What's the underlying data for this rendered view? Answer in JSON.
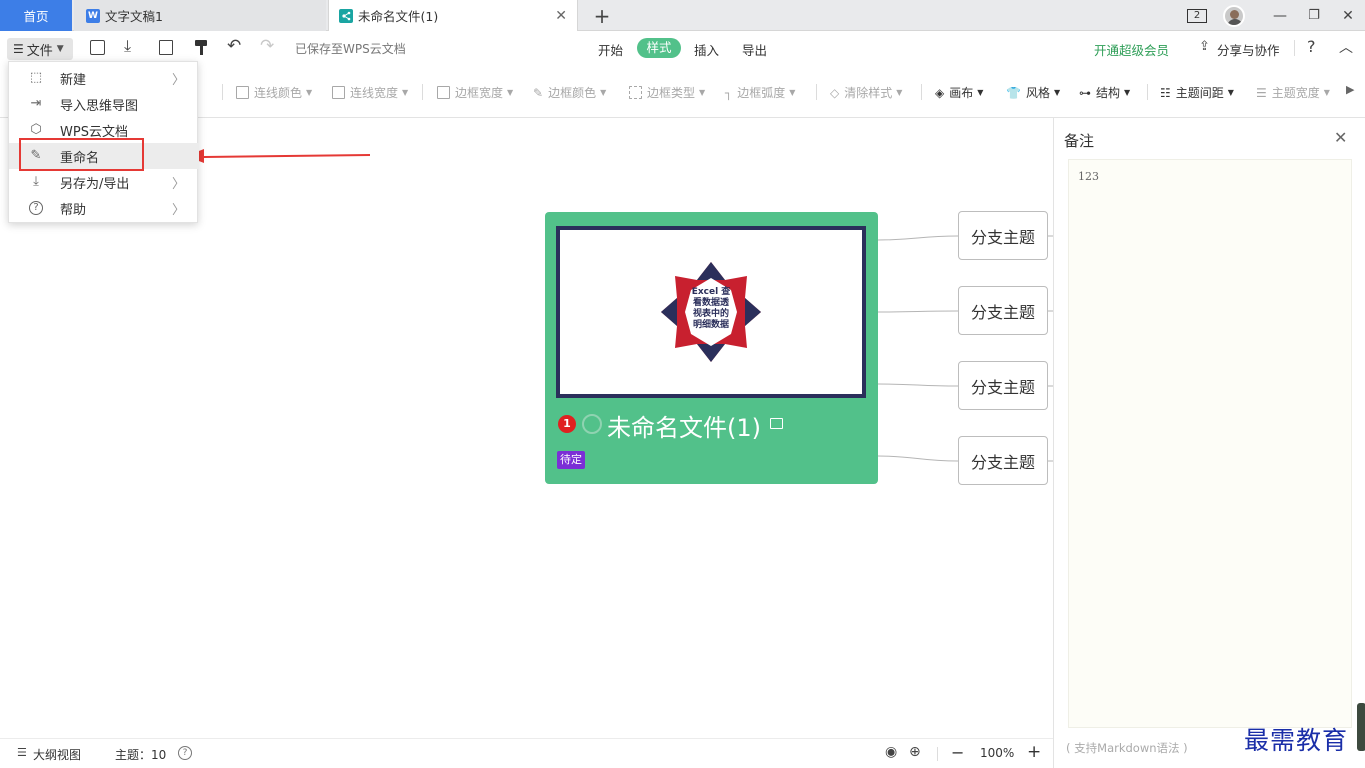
{
  "tabs": {
    "home": "首页",
    "doc": "文字文稿1",
    "mind": "未命名文件(1)"
  },
  "window": {
    "badge": "2"
  },
  "toolbar": {
    "file_label": "文件",
    "saved_status": "已保存至WPS云文档",
    "ribbon_tabs": [
      "开始",
      "样式",
      "插入",
      "导出"
    ],
    "vip": "开通超级会员",
    "share": "分享与协作",
    "help": "?"
  },
  "format_bar": {
    "line_color": "连线颜色",
    "line_width": "连线宽度",
    "border_width": "边框宽度",
    "border_color": "边框颜色",
    "border_type": "边框类型",
    "border_radius": "边框弧度",
    "clear_style": "清除样式",
    "canvas": "画布",
    "style": "风格",
    "structure": "结构",
    "topic_spacing": "主题间距",
    "topic_width": "主题宽度"
  },
  "file_menu": {
    "items": [
      {
        "label": "新建",
        "icon": "new-file-icon",
        "arrow": true
      },
      {
        "label": "导入思维导图",
        "icon": "import-icon",
        "arrow": false
      },
      {
        "label": "WPS云文档",
        "icon": "cloud-icon",
        "arrow": false
      },
      {
        "label": "重命名",
        "icon": "pencil-icon",
        "arrow": false
      },
      {
        "label": "另存为/导出",
        "icon": "download-icon",
        "arrow": true
      },
      {
        "label": "帮助",
        "icon": "help-icon",
        "arrow": true
      }
    ]
  },
  "mindmap": {
    "root": {
      "title": "未命名文件(1)",
      "priority": "1",
      "tag": "待定",
      "image_text": [
        "Excel 查",
        "看数据透",
        "视表中的",
        "明细数据"
      ],
      "color": "#52c18a"
    },
    "branches": [
      "分支主题",
      "分支主题",
      "分支主题",
      "分支主题"
    ]
  },
  "notes": {
    "title": "备注",
    "content": "123",
    "hint": "( 支持Markdown语法 )"
  },
  "statusbar": {
    "outline": "大纲视图",
    "topics": "主题：10",
    "zoom": "100%"
  },
  "watermark": "最需教育",
  "colors": {
    "accent": "#3d7ee7",
    "green": "#52c18a",
    "highlight": "#e53935",
    "vip": "#2e9e57"
  }
}
